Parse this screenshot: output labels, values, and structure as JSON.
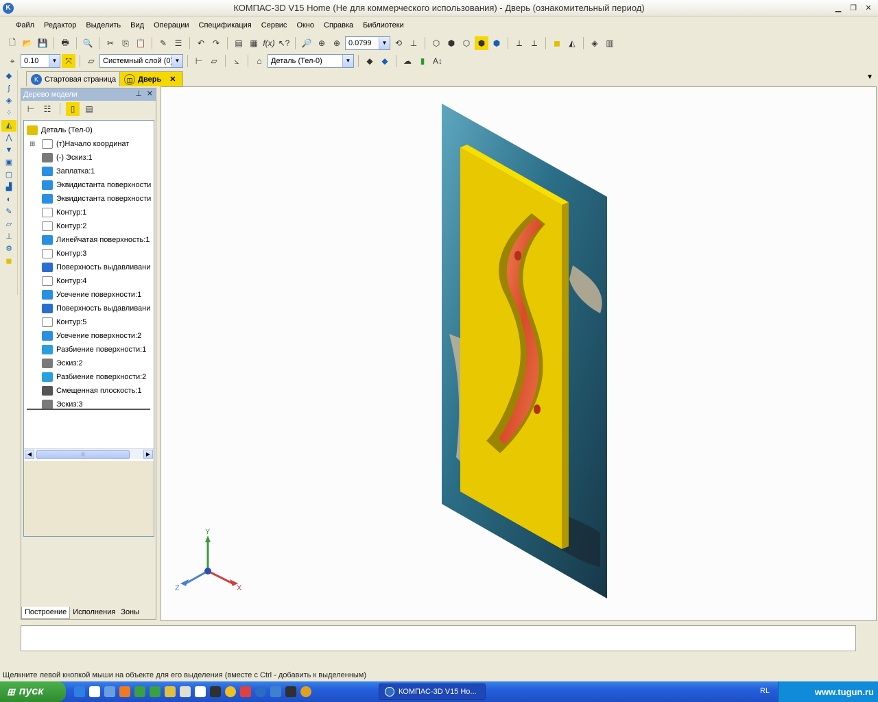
{
  "window": {
    "title": "КОМПАС-3D V15 Home (Не для коммерческого использования) - Дверь (ознакомительный период)"
  },
  "menu": [
    {
      "label": "Файл"
    },
    {
      "label": "Редактор"
    },
    {
      "label": "Выделить"
    },
    {
      "label": "Вид"
    },
    {
      "label": "Операции"
    },
    {
      "label": "Спецификация"
    },
    {
      "label": "Сервис"
    },
    {
      "label": "Окно"
    },
    {
      "label": "Справка"
    },
    {
      "label": "Библиотеки"
    }
  ],
  "toolbar": {
    "zoom_value": "0.0799"
  },
  "toolbar2": {
    "step_value": "0.10",
    "layer_value": "Системный слой (0)",
    "part_value": "Деталь (Тел-0)"
  },
  "tabs": [
    {
      "label": "Стартовая страница"
    },
    {
      "label": "Дверь",
      "close": "✕"
    }
  ],
  "tree_panel": {
    "title": "Дерево модели",
    "items": [
      {
        "label": "Деталь (Тел-0)",
        "icon": "part-icon"
      },
      {
        "label": "(т)Начало координат",
        "icon": "origin-icon"
      },
      {
        "label": "(-) Эскиз:1",
        "icon": "sketch-icon"
      },
      {
        "label": "Заплатка:1",
        "icon": "patch-icon"
      },
      {
        "label": "Эквидистанта поверхности",
        "icon": "offset-surface-icon"
      },
      {
        "label": "Эквидистанта поверхности",
        "icon": "offset-surface-icon"
      },
      {
        "label": "Контур:1",
        "icon": "contour-icon"
      },
      {
        "label": "Контур:2",
        "icon": "contour-icon"
      },
      {
        "label": "Линейчатая поверхность:1",
        "icon": "ruled-surface-icon"
      },
      {
        "label": "Контур:3",
        "icon": "contour-icon"
      },
      {
        "label": "Поверхность выдавливани",
        "icon": "extrude-surface-icon"
      },
      {
        "label": "Контур:4",
        "icon": "contour-icon"
      },
      {
        "label": "Усечение поверхности:1",
        "icon": "trim-surface-icon"
      },
      {
        "label": "Поверхность выдавливани",
        "icon": "extrude-surface-icon"
      },
      {
        "label": "Контур:5",
        "icon": "contour-icon"
      },
      {
        "label": "Усечение поверхности:2",
        "icon": "trim-surface-icon"
      },
      {
        "label": "Разбиение поверхности:1",
        "icon": "split-surface-icon"
      },
      {
        "label": "Эскиз:2",
        "icon": "sketch-icon"
      },
      {
        "label": "Разбиение поверхности:2",
        "icon": "split-surface-icon"
      },
      {
        "label": "Смещенная плоскость:1",
        "icon": "offset-plane-icon"
      },
      {
        "label": "Эскиз:3",
        "icon": "sketch-icon"
      }
    ],
    "bottom_tabs": [
      {
        "label": "Построение"
      },
      {
        "label": "Исполнения"
      },
      {
        "label": "Зоны"
      }
    ]
  },
  "axes": {
    "x": "X",
    "y": "Y",
    "z": "Z"
  },
  "status": "Щелкните левой кнопкой мыши на объекте для его выделения (вместе с Ctrl - добавить к выделенным)",
  "taskbar": {
    "start": "пуск",
    "window_button": "КОМПАС-3D V15 Ho...",
    "lang": "RL",
    "watermark": "www.tugun.ru"
  }
}
